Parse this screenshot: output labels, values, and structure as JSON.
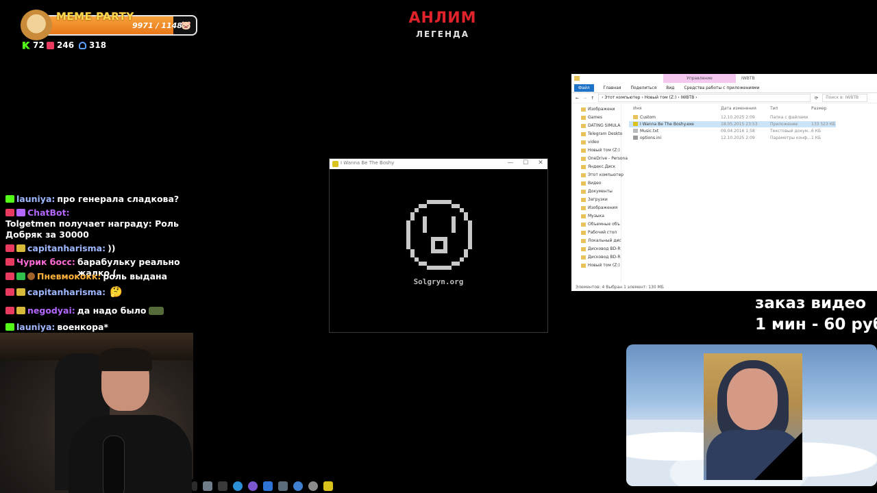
{
  "overlay": {
    "meme_title": "MEME PARTY",
    "meme_value": "9971 / 11488",
    "meme_progress": 0.868,
    "stats": {
      "kick": "72",
      "live": "246",
      "viewers": "318"
    },
    "stream_title": "АНЛИМ",
    "stream_subtitle": "ЛЕГЕНДА",
    "ad_line1": "заказ видео",
    "ad_line2": "1 мин - 60 руб"
  },
  "chat": [
    {
      "user": "launiya:",
      "user_color": "#9fb7ff",
      "text": "про генерала сладкова?"
    },
    {
      "user": "ChatBot:",
      "user_color": "#b467ff",
      "text": ""
    },
    {
      "user": "Tolgetmen",
      "user_color": "#ffffff",
      "text": "получает награду: Роль Добряк за 30000"
    },
    {
      "user": "capitanharisma:",
      "user_color": "#9fb7ff",
      "text": "))"
    },
    {
      "user": "Чурик босс:",
      "user_color": "#ff6bd6",
      "text": "барабульку реально жалко ("
    },
    {
      "user": "Пневмококк:",
      "user_color": "#ffb13b",
      "text": "роль выдана"
    },
    {
      "user": "capitanharisma:",
      "user_color": "#9fb7ff",
      "text": ""
    },
    {
      "user": "negodyai:",
      "user_color": "#b467ff",
      "text": "да надо было"
    },
    {
      "user": "launiya:",
      "user_color": "#9fb7ff",
      "text": "военкора*"
    }
  ],
  "game": {
    "title": "I Wanna Be The Boshy",
    "caption": "Solgryn.org",
    "controls": [
      "—",
      "☐",
      "✕"
    ]
  },
  "explorer": {
    "manage_tab": "Управление",
    "path_title": "IWBTB",
    "ribbon_tabs": [
      "Файл",
      "Главная",
      "Поделиться",
      "Вид",
      "Средства работы с приложениями"
    ],
    "breadcrumb": "›  Этот компьютер  ›  Новый том (Z:)  ›  IWBTB  ›",
    "search_placeholder": "Поиск в: IWBTB",
    "nav_items": [
      "Изображени",
      "Games",
      "DATING SIMULA",
      "Telegram Deskto",
      "video",
      "Новый том (Z:)",
      "OneDrive - Persona",
      "Яндекс.Диск",
      "Этот компьютер",
      "Видео",
      "Документы",
      "Загрузки",
      "Изображения",
      "Музыка",
      "Объемные объ",
      "Рабочий стол",
      "Локальный дис",
      "Дисковод BD-R",
      "Дисковод BD-R",
      "Новый том (Z:)"
    ],
    "columns": [
      "Имя",
      "Дата изменения",
      "Тип",
      "Размер"
    ],
    "files": [
      {
        "name": "Custom",
        "date": "12.10.2025 2:09",
        "type": "Папка с файлами",
        "size": "",
        "selected": false,
        "icon_color": "#e8c35a"
      },
      {
        "name": "I Wanna Be The Boshy.exe",
        "date": "18.05.2015 23:53",
        "type": "Приложение",
        "size": "133 523 КБ",
        "selected": true,
        "icon_color": "#d9c21b"
      },
      {
        "name": "Music.txt",
        "date": "09.04.2016 1:58",
        "type": "Текстовый докум...",
        "size": "6 КБ",
        "selected": false,
        "icon_color": "#bbbbbb"
      },
      {
        "name": "options.ini",
        "date": "12.10.2025 2:09",
        "type": "Параметры конф...",
        "size": "1 КБ",
        "selected": false,
        "icon_color": "#9a9a9a"
      }
    ],
    "status": "Элементов: 4     Выбран 1 элемент: 130 МБ"
  }
}
